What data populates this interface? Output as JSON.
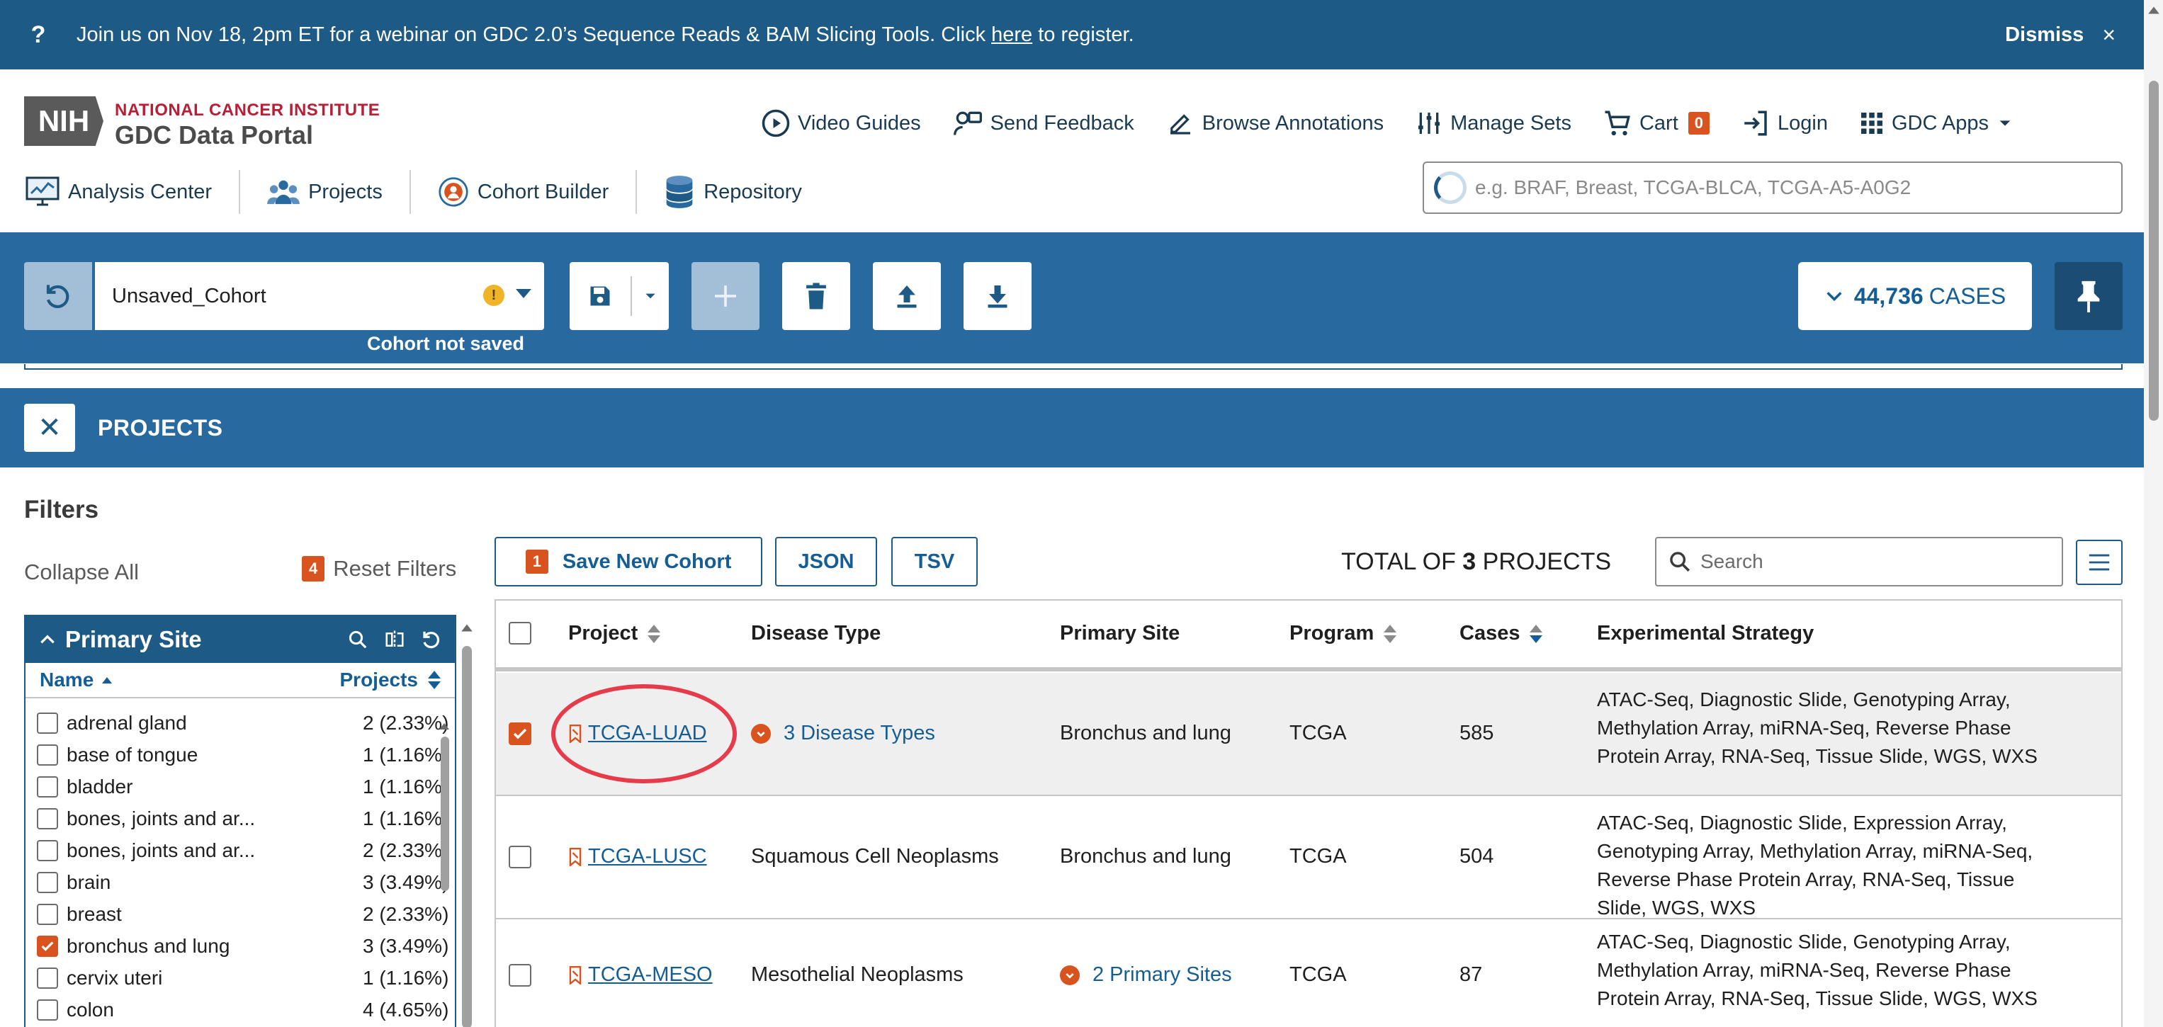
{
  "banner": {
    "icon": "question-icon",
    "text_before": "Join us on Nov 18, 2pm ET for a webinar on GDC 2.0’s Sequence Reads & BAM Slicing Tools. Click ",
    "link": "here",
    "text_after": " to register.",
    "dismiss": "Dismiss",
    "close": "×"
  },
  "logo": {
    "badge": "NIH",
    "org": "NATIONAL CANCER INSTITUTE",
    "product": "GDC Data Portal"
  },
  "topnav": {
    "video_guides": "Video Guides",
    "send_feedback": "Send Feedback",
    "browse_annotations": "Browse Annotations",
    "manage_sets": "Manage Sets",
    "cart": "Cart",
    "cart_count": "0",
    "login": "Login",
    "gdc_apps": "GDC Apps"
  },
  "subnav": {
    "analysis_center": "Analysis Center",
    "projects": "Projects",
    "cohort_builder": "Cohort Builder",
    "repository": "Repository"
  },
  "quicksearch": {
    "placeholder": "e.g. BRAF, Breast, TCGA-BLCA, TCGA-A5-A0G2"
  },
  "cohort": {
    "name": "Unsaved_Cohort",
    "warning": "!",
    "status": "Cohort not saved",
    "cases_count": "44,736",
    "cases_label": "CASES"
  },
  "projects_panel": {
    "close": "✕",
    "title": "PROJECTS"
  },
  "filters": {
    "title": "Filters",
    "collapse_all": "Collapse All",
    "reset_count": "4",
    "reset_label": "Reset Filters",
    "facet": {
      "title": "Primary Site",
      "col_name": "Name",
      "col_projects": "Projects",
      "items": [
        {
          "name": "adrenal gland",
          "count": "2 (2.33%)",
          "checked": false
        },
        {
          "name": "base of tongue",
          "count": "1 (1.16%)",
          "checked": false
        },
        {
          "name": "bladder",
          "count": "1 (1.16%)",
          "checked": false
        },
        {
          "name": "bones, joints and ar...",
          "count": "1 (1.16%)",
          "checked": false
        },
        {
          "name": "bones, joints and ar...",
          "count": "2 (2.33%)",
          "checked": false
        },
        {
          "name": "brain",
          "count": "3 (3.49%)",
          "checked": false
        },
        {
          "name": "breast",
          "count": "2 (2.33%)",
          "checked": false
        },
        {
          "name": "bronchus and lung",
          "count": "3 (3.49%)",
          "checked": true
        },
        {
          "name": "cervix uteri",
          "count": "1 (1.16%)",
          "checked": false
        },
        {
          "name": "colon",
          "count": "4 (4.65%)",
          "checked": false
        }
      ]
    }
  },
  "toolbar": {
    "save_count": "1",
    "save_label": "Save New Cohort",
    "json": "JSON",
    "tsv": "TSV",
    "total_prefix": "TOTAL OF",
    "total_count": "3",
    "total_suffix": "PROJECTS",
    "search_placeholder": "Search"
  },
  "table": {
    "headers": {
      "project": "Project",
      "disease_type": "Disease Type",
      "primary_site": "Primary Site",
      "program": "Program",
      "cases": "Cases",
      "experimental_strategy": "Experimental Strategy"
    },
    "rows": [
      {
        "project": "TCGA-LUAD",
        "disease_type": "3 Disease Types",
        "primary_site": "Bronchus and lung",
        "program": "TCGA",
        "cases": "585",
        "experimental_strategy": "ATAC-Seq, Diagnostic Slide, Genotyping Array, Methylation Array, miRNA-Seq, Reverse Phase Protein Array, RNA-Seq, Tissue Slide, WGS, WXS",
        "selected": true
      },
      {
        "project": "TCGA-LUSC",
        "disease_type": "Squamous Cell Neoplasms",
        "primary_site": "Bronchus and lung",
        "program": "TCGA",
        "cases": "504",
        "experimental_strategy": "ATAC-Seq, Diagnostic Slide, Expression Array, Genotyping Array, Methylation Array, miRNA-Seq, Reverse Phase Protein Array, RNA-Seq, Tissue Slide, WGS, WXS",
        "selected": false
      },
      {
        "project": "TCGA-MESO",
        "disease_type": "Mesothelial Neoplasms",
        "primary_site": "2 Primary Sites",
        "program": "TCGA",
        "cases": "87",
        "experimental_strategy": "ATAC-Seq, Diagnostic Slide, Genotyping Array, Methylation Array, miRNA-Seq, Reverse Phase Protein Array, RNA-Seq, Tissue Slide, WGS, WXS",
        "selected": false
      }
    ]
  },
  "colors": {
    "brand_blue": "#1d5a85",
    "bar_blue": "#2869a0",
    "accent_orange": "#d9531e",
    "annotation_red": "#e63b4a"
  }
}
